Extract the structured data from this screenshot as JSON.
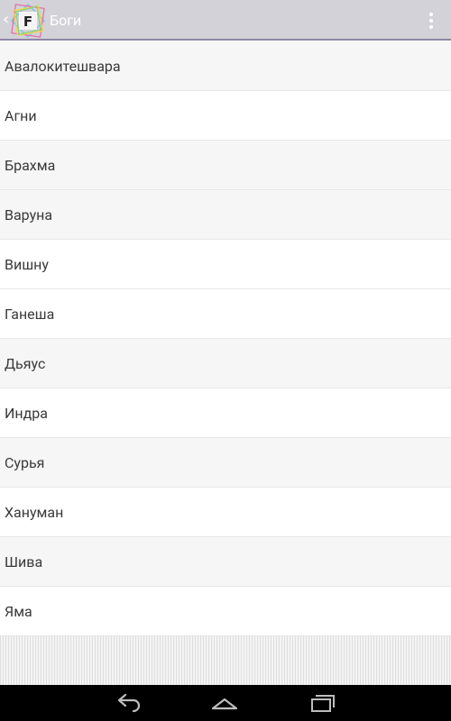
{
  "action_bar": {
    "title": "Боги",
    "logo_letter": "F",
    "icons": {
      "up": "chevron-left-icon",
      "logo": "app-logo-icon",
      "overflow": "overflow-menu-icon"
    },
    "colors": {
      "bar_bg": "#d2d2d8",
      "bar_border": "#8f86a6"
    }
  },
  "list": {
    "items": [
      {
        "label": "Авалокитешвара"
      },
      {
        "label": "Агни"
      },
      {
        "label": "Брахма"
      },
      {
        "label": "Варуна"
      },
      {
        "label": "Вишну"
      },
      {
        "label": "Ганеша"
      },
      {
        "label": "Дьяус"
      },
      {
        "label": "Индра"
      },
      {
        "label": "Сурья"
      },
      {
        "label": "Хануман"
      },
      {
        "label": "Шива"
      },
      {
        "label": "Яма"
      }
    ]
  },
  "nav_bar": {
    "icons": [
      "back-icon",
      "home-icon",
      "recent-apps-icon"
    ]
  }
}
